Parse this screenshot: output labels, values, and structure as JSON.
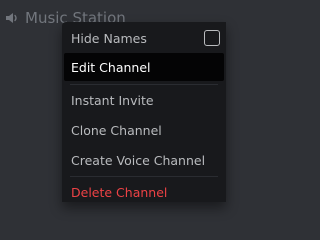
{
  "channel": {
    "name": "Music Station",
    "icon": "speaker-icon"
  },
  "context_menu": {
    "hide_names": {
      "label": "Hide Names",
      "checked": false
    },
    "edit_channel": {
      "label": "Edit Channel"
    },
    "instant_invite": {
      "label": "Instant Invite"
    },
    "clone_channel": {
      "label": "Clone Channel"
    },
    "create_voice_channel": {
      "label": "Create Voice Channel"
    },
    "delete_channel": {
      "label": "Delete Channel"
    }
  },
  "colors": {
    "background": "#2f3136",
    "menu_bg": "#18191c",
    "active_bg": "#040405",
    "text": "#b9bbbe",
    "danger": "#ed4245"
  }
}
